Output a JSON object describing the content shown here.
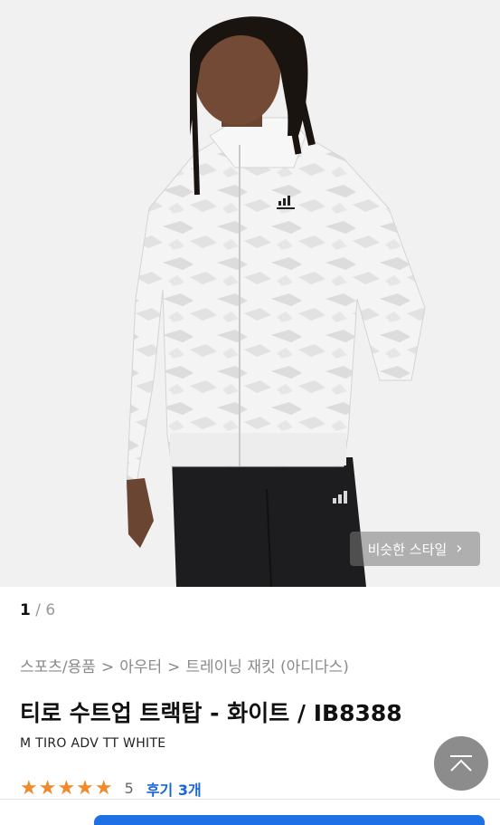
{
  "hero": {
    "similar_style_label": "비슷한 스타일"
  },
  "pager": {
    "current": "1",
    "separator": "/",
    "total": "6"
  },
  "breadcrumb": {
    "items": [
      "스포츠/용품",
      "아우터",
      "트레이닝 재킷 (아디다스)"
    ],
    "separator": ">"
  },
  "product": {
    "title": "티로 수트업 트랙탑 - 화이트 / IB8388",
    "subtitle": "M TIRO ADV TT WHITE"
  },
  "rating": {
    "stars": "★★★★★",
    "score": "5",
    "reviews_label": "후기 3개"
  },
  "colors": {
    "star": "#f08a2a",
    "link": "#1a66d6",
    "cta": "#1f6fe5"
  },
  "icons": {
    "scroll_top": "arrow-up-icon",
    "chevron": "chevron-right-icon"
  }
}
